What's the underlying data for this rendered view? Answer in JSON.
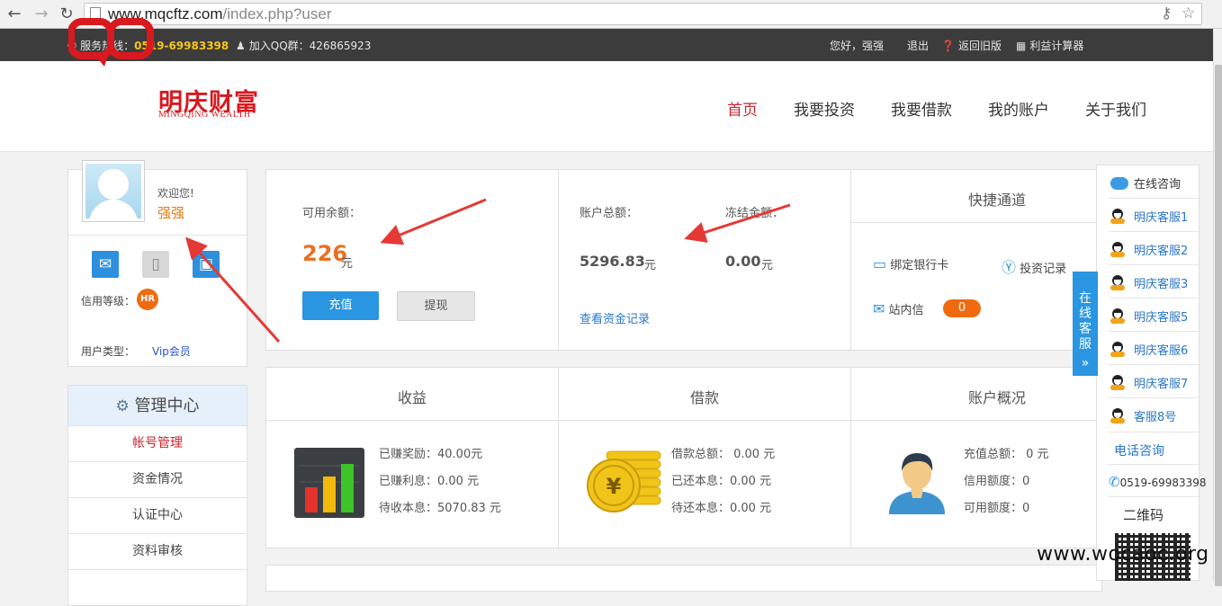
{
  "browser": {
    "url_host": "www.mqcftz.com",
    "url_path": "/index.php?user"
  },
  "topbar": {
    "hotline_label": "服务热线：",
    "hotline": "0519-69983398",
    "qq_label": "加入QQ群：",
    "qq": "426865923",
    "greeting": "您好，强强",
    "logout": "退出",
    "old_version": "返回旧版",
    "calculator": "利益计算器"
  },
  "logo": {
    "name": "明庆财富",
    "en": "MINGQING WEALTH"
  },
  "nav": [
    "首页",
    "我要投资",
    "我要借款",
    "我的账户",
    "关于我们"
  ],
  "user": {
    "welcome": "欢迎您!",
    "name": "强强",
    "credit_label": "信用等级：",
    "credit_badge": "HR",
    "type_label": "用户类型：",
    "type_value": "Vip会员"
  },
  "sidebar": {
    "title": "管理中心",
    "items": [
      "帐号管理",
      "资金情况",
      "认证中心",
      "资料审核"
    ]
  },
  "balance": {
    "available_label": "可用余额：",
    "available_value": "226",
    "unit": "元",
    "recharge": "充值",
    "withdraw": "提现"
  },
  "account": {
    "total_label": "账户总额：",
    "total_value": "5296.83",
    "frozen_label": "冻结金额：",
    "frozen_value": "0.00",
    "unit": "元",
    "records_link": "查看资金记录"
  },
  "shortcuts": {
    "title": "快捷通道",
    "bind_card": "绑定银行卡",
    "invest_records": "投资记录",
    "messages": "站内信",
    "message_count": "0"
  },
  "income": {
    "title": "收益",
    "line1": "已赚奖励：40.00元",
    "line2": "已赚利息：0.00 元",
    "line3": "待收本息：5070.83 元"
  },
  "loan": {
    "title": "借款",
    "line1": "借款总额： 0.00 元",
    "line2": "已还本息：0.00 元",
    "line3": "待还本息：0.00 元"
  },
  "overview": {
    "title": "账户概况",
    "line1": "充值总额： 0 元",
    "line2": "信用额度：0",
    "line3": "可用额度：0"
  },
  "support": {
    "online": "在线咨询",
    "agents": [
      "明庆客服1",
      "明庆客服2",
      "明庆客服3",
      "明庆客服5",
      "明庆客服6",
      "明庆客服7",
      "客服8号"
    ],
    "phone_title": "电话咨询",
    "phone": "0519-69983398",
    "qr_title": "二维码",
    "tab_label": "在线客服"
  },
  "watermark": "www.wocaoc.org"
}
